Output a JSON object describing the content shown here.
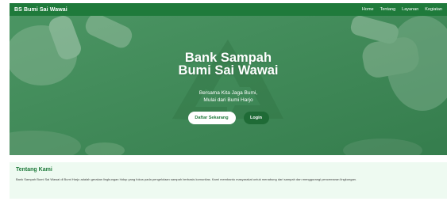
{
  "navbar": {
    "brand": "BS Bumi Sai Wawai",
    "links": [
      "Home",
      "Tentang",
      "Layanan",
      "Kegiatan"
    ]
  },
  "hero": {
    "title_line1": "Bank Sampah",
    "title_line2": "Bumi Sai Wawai",
    "subtitle_line1": "Bersama Kita Jaga Bumi,",
    "subtitle_line2": "Mulai dari Bumi Harjo",
    "register_label": "Daftar Sekarang",
    "login_label": "Login",
    "background_icon": "recycle-icon"
  },
  "about": {
    "title": "Tentang Kami",
    "text": "Bank Sampah Bumi Sai Wawai di Bumi Harjo adalah gerakan lingkungan hidup yang fokus pada pengelolaan sampah berbasis komunitas. Kami membantu masyarakat untuk menabung dari sampah dan menggurangi pencemaran lingkungan."
  },
  "colors": {
    "primary": "#1f7a3b",
    "hero_overlay": "#3e8a57",
    "about_bg": "#eefaf1"
  }
}
